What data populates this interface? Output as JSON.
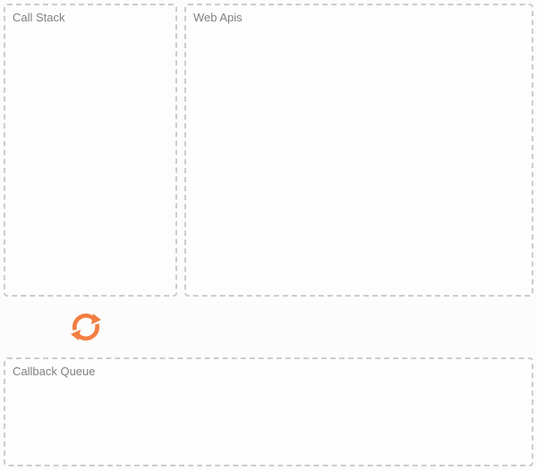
{
  "panels": {
    "call_stack": {
      "label": "Call Stack"
    },
    "web_apis": {
      "label": "Web Apis"
    },
    "callback_queue": {
      "label": "Callback Queue"
    }
  },
  "colors": {
    "accent": "#f47e42",
    "border": "#cccccc",
    "text": "#808080"
  }
}
